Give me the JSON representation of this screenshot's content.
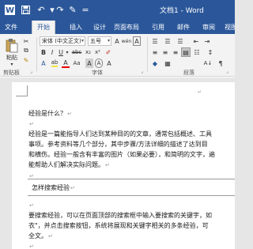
{
  "window": {
    "title": "文档1 - Word"
  },
  "quick_access": [
    {
      "name": "word-logo-icon",
      "glyph": "W"
    },
    {
      "name": "save-icon",
      "glyph": "▣"
    },
    {
      "name": "undo-icon",
      "glyph": "↶"
    },
    {
      "name": "redo-icon",
      "glyph": "↷"
    },
    {
      "name": "format-painter-qa-icon",
      "glyph": "✎"
    },
    {
      "name": "customize-icon",
      "glyph": "="
    }
  ],
  "tabs": [
    "文件",
    "开始",
    "插入",
    "设计",
    "页面布局",
    "引用",
    "邮件",
    "审阅",
    "视图"
  ],
  "ribbon": {
    "paste_label": "粘贴",
    "clipboard_label": "剪贴板",
    "font_label": "字体",
    "paragraph_label": "段落",
    "font_name": "宋体 (中文正文)",
    "font_size": "五号",
    "font_row1": [
      "A",
      "wén",
      "A"
    ],
    "font_row2": [
      "B",
      "I",
      "U",
      "abc",
      "x₂",
      "x²",
      "A"
    ],
    "font_row3": [
      "A",
      "ab",
      "A",
      "Aa",
      "A",
      "A",
      "A"
    ],
    "para_row1": [
      "☰",
      "☰",
      "☰",
      "⇤",
      "⇥"
    ],
    "para_row2": [
      "≡",
      "≡",
      "≡",
      "▤",
      "☷",
      "↕"
    ],
    "para_row3": [
      "◆",
      "▦",
      "A↓",
      "¶"
    ]
  },
  "document": {
    "paragraphs": [
      "经验是什么？",
      "经验是一篇能指导人们达到某种目的的文章，通常包括概述、工具",
      "事项。参考资料等几个部分，其中步骤/方法详细的描述了达到目",
      "和横伤。经验一般含有丰富的图片（如果必要），和简明的文字，遍",
      "能帮助人们解决实际问题。",
      "怎样搜索经验",
      "要搜索经验，可以在页面顶部的搜索框中输入要搜索的关键字，如",
      "衣\"，并点击搜索按钮，系统将展现和关键字相关的多条经验，可",
      "全文。"
    ],
    "paragraph_mark": "↵"
  }
}
